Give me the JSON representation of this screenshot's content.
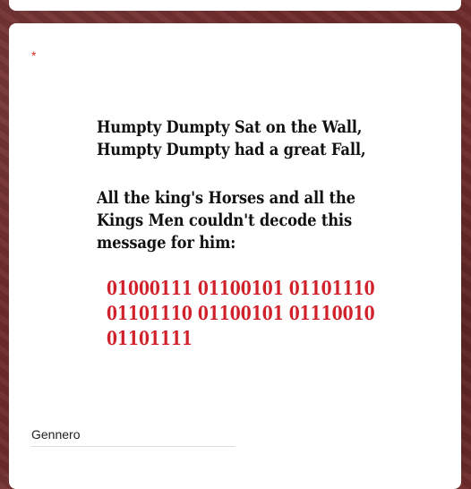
{
  "question": {
    "required_marker": "*",
    "image_text": {
      "rhyme_lines": [
        "Humpty Dumpty Sat on the Wall,",
        "Humpty Dumpty had a great Fall,"
      ],
      "riddle_lines": [
        "All the king's Horses and all the",
        "Kings Men couldn't decode this",
        "message for him:"
      ],
      "binary_lines": [
        "01000111 01100101 01101110",
        "01101110 01100101 01110010",
        "01101111"
      ]
    }
  },
  "answer": {
    "value": "Gennero"
  },
  "colors": {
    "background": "#6e2b2b",
    "required": "#d93025",
    "binary_text": "#d0202a"
  }
}
